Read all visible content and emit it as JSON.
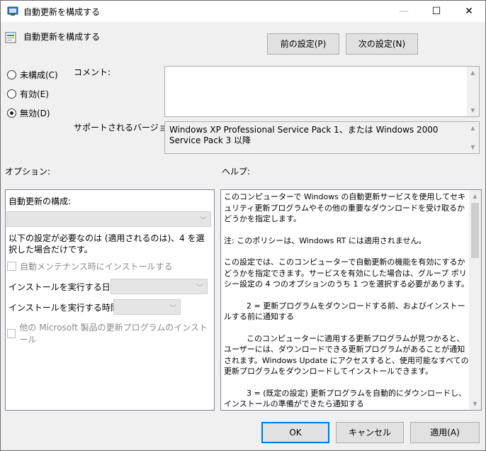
{
  "window": {
    "title": "自動更新を構成する",
    "minimize_glyph": "—",
    "maximize_glyph": "☐",
    "close_glyph": "✕"
  },
  "header": {
    "policy_name": "自動更新を構成する",
    "prev_button": "前の設定(P)",
    "next_button": "次の設定(N)"
  },
  "state": {
    "options": [
      {
        "label": "未構成(C)",
        "selected": false
      },
      {
        "label": "有効(E)",
        "selected": false
      },
      {
        "label": "無効(D)",
        "selected": true
      }
    ]
  },
  "comment": {
    "label": "コメント:",
    "value": ""
  },
  "supported": {
    "label": "サポートされるバージョン:",
    "value": "Windows XP Professional Service Pack 1、または Windows 2000 Service Pack 3 以降"
  },
  "options_pane": {
    "heading": "オプション:",
    "config_label": "自動更新の構成:",
    "config_value": "",
    "note": "以下の設定が必要なのは (適用されるのは)、4 を選択した場合だけです。",
    "auto_maintenance_label": "自動メンテナンス時にインストールする",
    "install_day_label": "インストールを実行する日:",
    "install_time_label": "インストールを実行する時間:",
    "other_products_label": "他の Microsoft 製品の更新プログラムのインストール"
  },
  "help_pane": {
    "heading": "ヘルプ:",
    "paragraphs": [
      "このコンピューターで Windows の自動更新サービスを使用してセキュリティ更新プログラムやその他の重要なダウンロードを受け取るかどうかを指定します。",
      "注: このポリシーは、Windows RT には適用されません。",
      "この設定では、このコンピューターで自動更新の機能を有効にするかどうかを指定できます。サービスを有効にした場合は、グループ ポリシー設定の 4 つのオプションのうち 1 つを選択する必要があります。",
      "2 = 更新プログラムをダウンロードする前、およびインストールする前に通知する",
      "このコンピューターに適用する更新プログラムが見つかると、ユーザーには、ダウンロードできる更新プログラムがあることが通知されます。Windows Update にアクセスすると、使用可能なすべての更新プログラムをダウンロードしてインストールできます。",
      "3 = (既定の設定) 更新プログラムを自動的にダウンロードし、インストールの準備ができたら通知する"
    ]
  },
  "footer": {
    "ok": "OK",
    "cancel": "キャンセル",
    "apply": "適用(A)"
  }
}
